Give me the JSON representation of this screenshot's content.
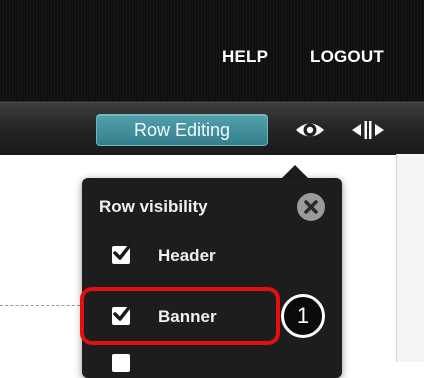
{
  "header": {
    "links": [
      "HELP",
      "LOGOUT"
    ]
  },
  "toolbar": {
    "row_editing_label": "Row Editing",
    "eye_icon": "eye-icon",
    "resize_icon": "resize-horizontal-icon"
  },
  "popup": {
    "title": "Row visibility",
    "close_icon": "close-icon",
    "items": [
      {
        "label": "Header",
        "checked": true
      },
      {
        "label": "Banner",
        "checked": true
      }
    ]
  },
  "annotation": {
    "step": "1",
    "highlight_color": "#e01010"
  }
}
